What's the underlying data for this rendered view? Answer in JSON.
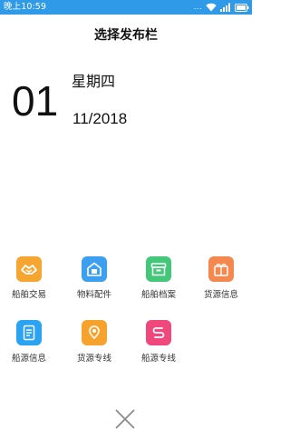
{
  "status_bar": {
    "time": "晚上10:59",
    "dots": "...",
    "icons": [
      "wifi-icon",
      "signal-icon",
      "battery-icon"
    ]
  },
  "header": {
    "title": "选择发布栏"
  },
  "date": {
    "day": "01",
    "weekday": "星期四",
    "month_year": "11/2018"
  },
  "grid": {
    "items": [
      {
        "label": "船舶交易",
        "icon": "handshake-icon",
        "color": "#f6a531"
      },
      {
        "label": "物料配件",
        "icon": "house-box-icon",
        "color": "#3c9ff0"
      },
      {
        "label": "船舶档案",
        "icon": "archive-icon",
        "color": "#42c878"
      },
      {
        "label": "货源信息",
        "icon": "gift-box-icon",
        "color": "#f4884f"
      },
      {
        "label": "船源信息",
        "icon": "document-icon",
        "color": "#2aa3f2"
      },
      {
        "label": "货源专线",
        "icon": "map-pin-icon",
        "color": "#f7a22c"
      },
      {
        "label": "船源专线",
        "icon": "route-icon",
        "color": "#f0477d"
      }
    ]
  },
  "footer": {
    "close_icon": "close-icon"
  }
}
